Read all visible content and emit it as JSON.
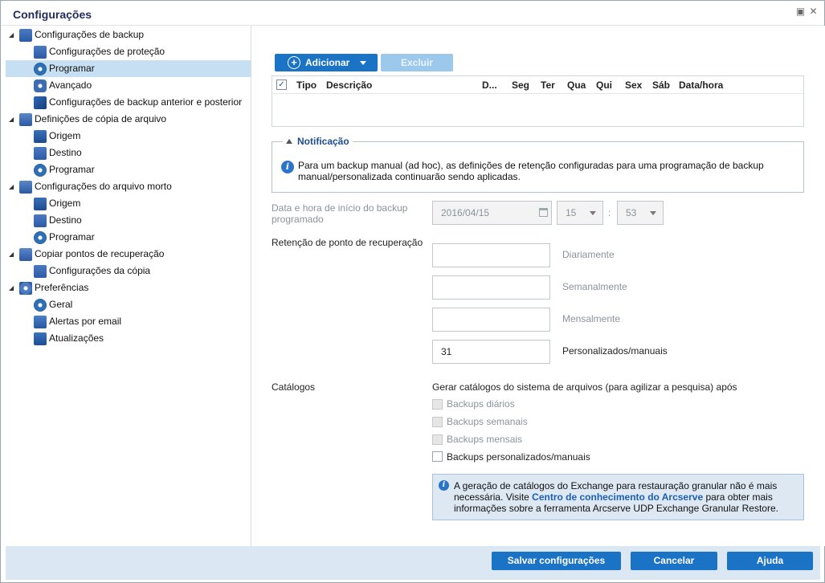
{
  "window": {
    "title": "Configurações"
  },
  "tree": [
    {
      "label": "Configurações de backup",
      "level": 0,
      "icon": "backup-settings-icon",
      "expander": "◢"
    },
    {
      "label": "Configurações de proteção",
      "level": 1,
      "icon": "protection-icon"
    },
    {
      "label": "Programar",
      "level": 1,
      "icon": "schedule-icon",
      "selected": true
    },
    {
      "label": "Avançado",
      "level": 1,
      "icon": "advanced-icon"
    },
    {
      "label": "Configurações de backup anterior e posterior",
      "level": 1,
      "icon": "wrench-icon"
    },
    {
      "label": "Definições de cópia de arquivo",
      "level": 0,
      "icon": "file-copy-icon",
      "expander": "◢"
    },
    {
      "label": "Origem",
      "level": 1,
      "icon": "source-icon"
    },
    {
      "label": "Destino",
      "level": 1,
      "icon": "destination-icon"
    },
    {
      "label": "Programar",
      "level": 1,
      "icon": "schedule-icon"
    },
    {
      "label": "Configurações do arquivo morto",
      "level": 0,
      "icon": "archive-icon",
      "expander": "◢"
    },
    {
      "label": "Origem",
      "level": 1,
      "icon": "source-icon"
    },
    {
      "label": "Destino",
      "level": 1,
      "icon": "destination-icon"
    },
    {
      "label": "Programar",
      "level": 1,
      "icon": "schedule-icon"
    },
    {
      "label": "Copiar pontos de recuperação",
      "level": 0,
      "icon": "copy-recovery-icon",
      "expander": "◢"
    },
    {
      "label": "Configurações da cópia",
      "level": 1,
      "icon": "copy-settings-icon"
    },
    {
      "label": "Preferências",
      "level": 0,
      "icon": "preferences-icon",
      "expander": "◢"
    },
    {
      "label": "Geral",
      "level": 1,
      "icon": "general-icon"
    },
    {
      "label": "Alertas por email",
      "level": 1,
      "icon": "email-icon"
    },
    {
      "label": "Atualizações",
      "level": 1,
      "icon": "updates-icon"
    }
  ],
  "toolbar": {
    "add_label": "Adicionar",
    "delete_label": "Excluir"
  },
  "schedule_table": {
    "columns": [
      "Tipo",
      "Descrição",
      "D...",
      "Seg",
      "Ter",
      "Qua",
      "Qui",
      "Sex",
      "Sáb",
      "Data/hora"
    ],
    "rows": []
  },
  "notification": {
    "legend": "Notificação",
    "text": "Para um backup manual (ad hoc), as definições de retenção configuradas para uma programação de backup manual/personalizada continuarão sendo aplicadas."
  },
  "start_time": {
    "label": "Data e hora de início do backup programado",
    "date": "2016/04/15",
    "hour": "15",
    "separator": ":",
    "minute": "53"
  },
  "retention": {
    "label": "Retenção de ponto de recuperação",
    "daily_value": "",
    "daily_label": "Diariamente",
    "weekly_value": "",
    "weekly_label": "Semanalmente",
    "monthly_value": "",
    "monthly_label": "Mensalmente",
    "custom_value": "31",
    "custom_label": "Personalizados/manuais"
  },
  "catalogs": {
    "label": "Catálogos",
    "description": "Gerar catálogos do sistema de arquivos (para agilizar a pesquisa) após",
    "options": [
      {
        "label": "Backups diários",
        "disabled": true
      },
      {
        "label": "Backups semanais",
        "disabled": true
      },
      {
        "label": "Backups mensais",
        "disabled": true
      },
      {
        "label": "Backups personalizados/manuais",
        "disabled": false
      }
    ],
    "info_before": "A geração de catálogos do Exchange para restauração granular não é mais necessária. Visite ",
    "info_link": "Centro de conhecimento do Arcserve",
    "info_after": " para obter mais informações sobre a ferramenta Arcserve UDP Exchange Granular Restore."
  },
  "footer": {
    "save_label": "Salvar configurações",
    "cancel_label": "Cancelar",
    "help_label": "Ajuda"
  },
  "colors": {
    "accent": "#1b73c6",
    "selected_row": "#c6dff2",
    "footer_bg": "#dbe7f3"
  }
}
